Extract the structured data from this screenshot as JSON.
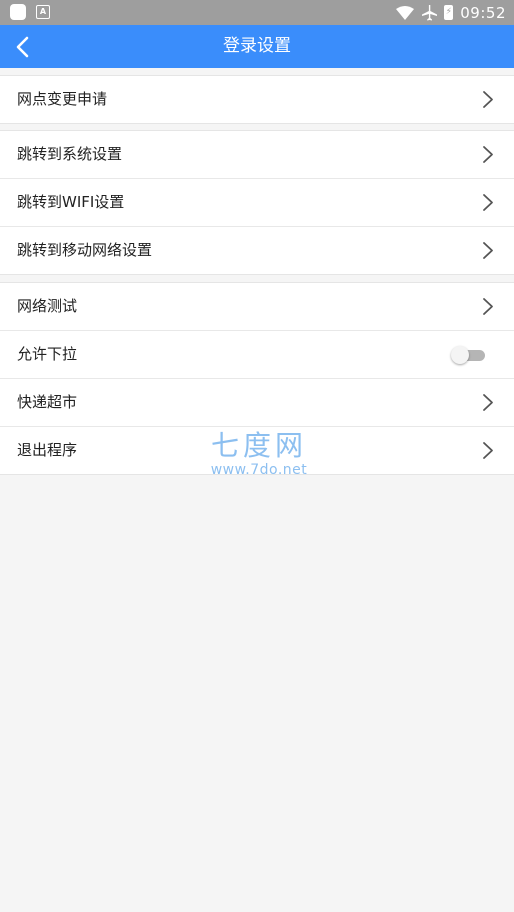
{
  "status_bar": {
    "time": "09:52",
    "icons": [
      "notification-square-icon",
      "a-badge-icon",
      "wifi-icon",
      "airplane-icon",
      "battery-icon"
    ]
  },
  "app_bar": {
    "title": "登录设置",
    "back_icon": "chevron-left-icon",
    "background": "#3a8dfb"
  },
  "settings": {
    "group1": [
      {
        "label": "网点变更申请"
      }
    ],
    "group2": [
      {
        "label": "跳转到系统设置"
      },
      {
        "label": "跳转到WIFI设置"
      },
      {
        "label": "跳转到移动网络设置"
      }
    ],
    "group3": [
      {
        "label": "网络测试"
      },
      {
        "label": "允许下拉",
        "toggle": false
      },
      {
        "label": "快递超市"
      },
      {
        "label": "退出程序"
      }
    ]
  },
  "watermark": {
    "title": "七度网",
    "url": "www.7do.net"
  }
}
